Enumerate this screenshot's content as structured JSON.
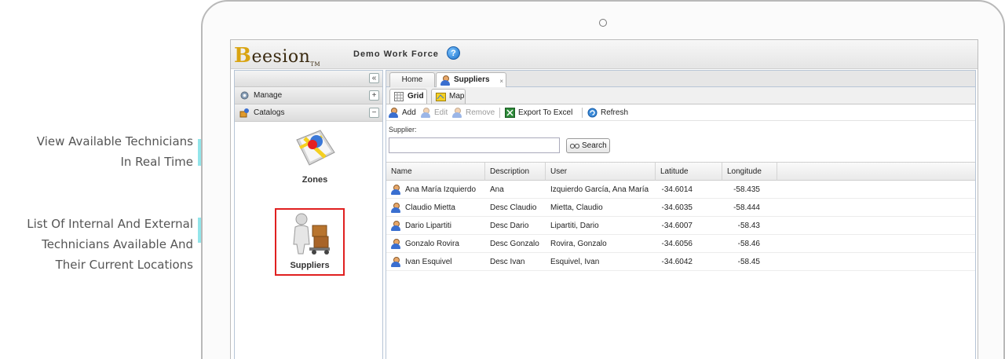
{
  "callouts": [
    {
      "lines": [
        "View Available Technicians",
        "In Real Time"
      ]
    },
    {
      "lines": [
        "List Of Internal And External",
        "Technicians Available And",
        "Their Current Locations"
      ]
    }
  ],
  "app": {
    "logo_text": "Beesion",
    "logo_mark": "TM",
    "title": "Demo Work Force",
    "help_icon": "?"
  },
  "left_panel": {
    "collapse": "«",
    "sections": [
      {
        "label": "Manage",
        "toggle": "+",
        "icon": "manage-icon"
      },
      {
        "label": "Catalogs",
        "toggle": "−",
        "icon": "catalogs-icon"
      }
    ],
    "items": [
      {
        "label": "Zones",
        "icon": "zones-map-icon"
      },
      {
        "label": "Suppliers",
        "icon": "suppliers-icon"
      }
    ]
  },
  "tabs": [
    {
      "label": "Home"
    },
    {
      "label": "Suppliers",
      "close": "×"
    }
  ],
  "subtabs": [
    {
      "label": "Grid"
    },
    {
      "label": "Map"
    }
  ],
  "toolbar": {
    "add": "Add",
    "edit": "Edit",
    "remove": "Remove",
    "export": "Export To Excel",
    "refresh": "Refresh"
  },
  "filter": {
    "label": "Supplier:",
    "value": "",
    "search": "Search"
  },
  "grid": {
    "columns": [
      "Name",
      "Description",
      "User",
      "Latitude",
      "Longitude"
    ],
    "rows": [
      [
        "Ana María Izquierdo",
        "Ana",
        "Izquierdo García, Ana María",
        "-34.6014",
        "-58.435"
      ],
      [
        "Claudio Mietta",
        "Desc Claudio",
        "Mietta, Claudio",
        "-34.6035",
        "-58.444"
      ],
      [
        "Dario Lipartiti",
        "Desc Dario",
        "Lipartiti, Dario",
        "-34.6007",
        "-58.43"
      ],
      [
        "Gonzalo Rovira",
        "Desc Gonzalo",
        "Rovira, Gonzalo",
        "-34.6056",
        "-58.46"
      ],
      [
        "Ivan Esquivel",
        "Desc Ivan",
        "Esquivel, Ivan",
        "-34.6042",
        "-58.45"
      ]
    ]
  },
  "colors": {
    "accent_arrow": "#7fe0e6",
    "highlight_border": "#e02020",
    "panel_border": "#b7c5d6"
  }
}
